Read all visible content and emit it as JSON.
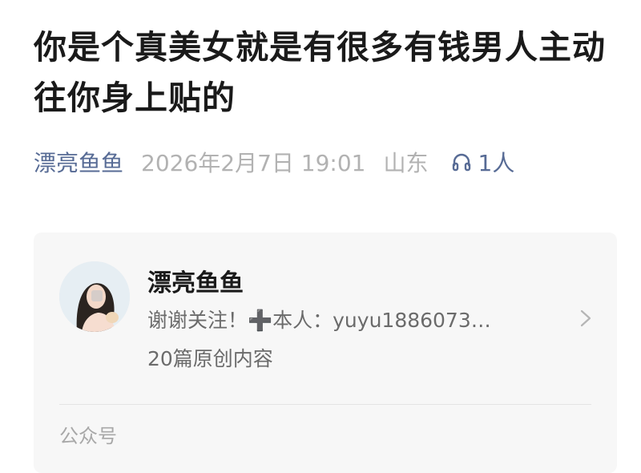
{
  "article": {
    "title": "你是个真美女就是有很多有钱男人主动往你身上贴的",
    "author": "漂亮鱼鱼",
    "date": "2026年2月7日 19:01",
    "location": "山东",
    "listeners": "1人"
  },
  "account_card": {
    "name": "漂亮鱼鱼",
    "description": "谢谢关注！➕本人：yuyu1886073…",
    "content_count": "20篇原创内容",
    "type_label": "公众号"
  },
  "icons": {
    "listen": "headphones-icon",
    "chevron": "chevron-right-icon"
  },
  "colors": {
    "link_blue": "#576b95",
    "meta_gray": "#b2b2b2",
    "card_bg": "#f7f7f7"
  }
}
